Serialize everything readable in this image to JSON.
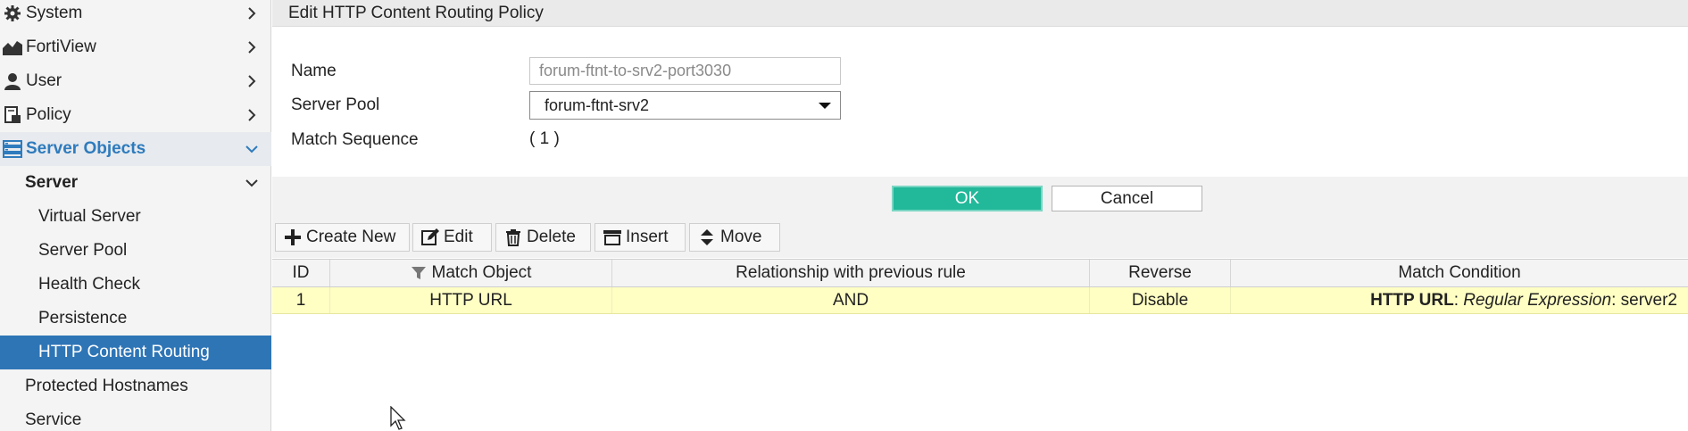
{
  "sidebar": {
    "items": [
      {
        "label": "System",
        "icon": "gear-icon"
      },
      {
        "label": "FortiView",
        "icon": "chart-icon"
      },
      {
        "label": "User",
        "icon": "user-icon"
      },
      {
        "label": "Policy",
        "icon": "policy-icon"
      },
      {
        "label": "Server Objects",
        "icon": "server-icon"
      },
      {
        "label": "Server"
      },
      {
        "label": "Virtual Server"
      },
      {
        "label": "Server Pool"
      },
      {
        "label": "Health Check"
      },
      {
        "label": "Persistence"
      },
      {
        "label": "HTTP Content Routing"
      },
      {
        "label": "Protected Hostnames"
      },
      {
        "label": "Service"
      }
    ]
  },
  "page": {
    "title": "Edit HTTP Content Routing Policy"
  },
  "form": {
    "name_label": "Name",
    "name_value": "forum-ftnt-to-srv2-port3030",
    "server_pool_label": "Server Pool",
    "server_pool_value": "forum-ftnt-srv2",
    "match_sequence_label": "Match Sequence",
    "match_sequence_value": "( 1 )"
  },
  "buttons": {
    "ok": "OK",
    "cancel": "Cancel"
  },
  "toolbar": {
    "create_new": "Create New",
    "edit": "Edit",
    "delete": "Delete",
    "insert": "Insert",
    "move": "Move"
  },
  "table": {
    "headers": [
      "ID",
      "Match Object",
      "Relationship with previous rule",
      "Reverse",
      "Match Condition"
    ],
    "rows": [
      {
        "id": "1",
        "match_object": "HTTP URL",
        "relationship": "AND",
        "reverse": "Disable",
        "cond_object": "HTTP URL",
        "cond_sep1": ": ",
        "cond_type": "Regular Expression",
        "cond_sep2": ": ",
        "cond_value": "server2"
      }
    ]
  },
  "colors": {
    "accent": "#2e75b6",
    "ok_button": "#22b89a",
    "row_highlight": "#ffffc4"
  }
}
